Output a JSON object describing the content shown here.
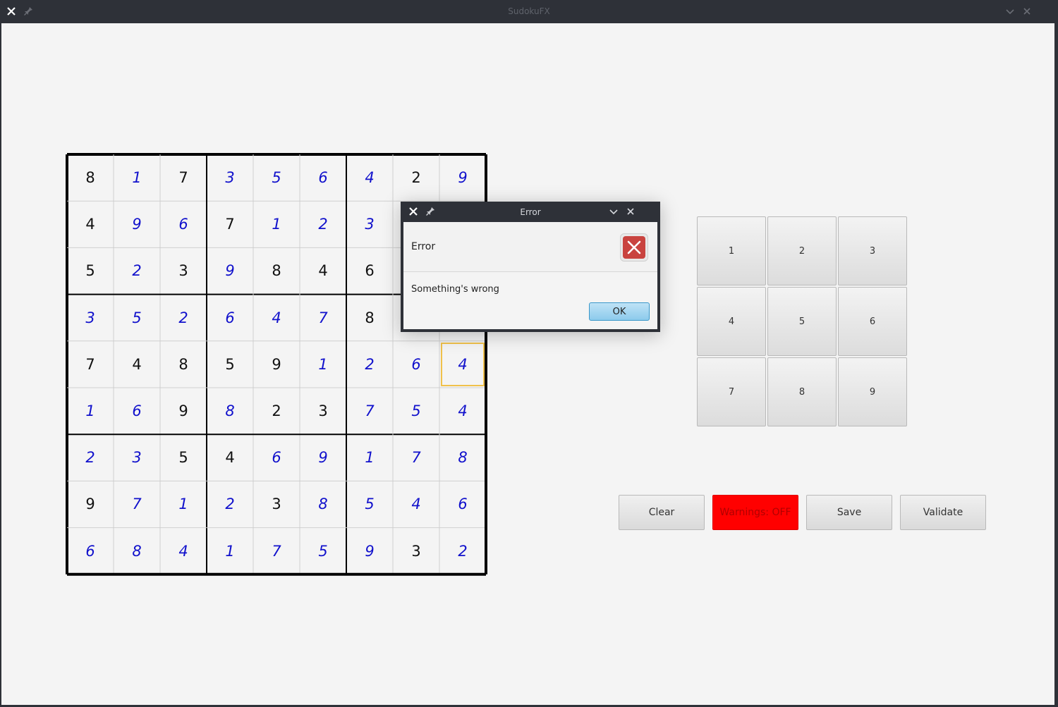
{
  "window": {
    "title": "SudokuFX"
  },
  "board": {
    "rows": [
      [
        {
          "v": "8",
          "t": "given"
        },
        {
          "v": "1",
          "t": "user"
        },
        {
          "v": "7",
          "t": "given"
        },
        {
          "v": "3",
          "t": "user"
        },
        {
          "v": "5",
          "t": "user"
        },
        {
          "v": "6",
          "t": "user"
        },
        {
          "v": "4",
          "t": "user"
        },
        {
          "v": "2",
          "t": "given"
        },
        {
          "v": "9",
          "t": "user"
        }
      ],
      [
        {
          "v": "4",
          "t": "given"
        },
        {
          "v": "9",
          "t": "user"
        },
        {
          "v": "6",
          "t": "user"
        },
        {
          "v": "7",
          "t": "given"
        },
        {
          "v": "1",
          "t": "user"
        },
        {
          "v": "2",
          "t": "user"
        },
        {
          "v": "3",
          "t": "user"
        },
        {
          "v": "",
          "t": "user"
        },
        {
          "v": "",
          "t": "user"
        }
      ],
      [
        {
          "v": "5",
          "t": "given"
        },
        {
          "v": "2",
          "t": "user"
        },
        {
          "v": "3",
          "t": "given"
        },
        {
          "v": "9",
          "t": "user"
        },
        {
          "v": "8",
          "t": "given"
        },
        {
          "v": "4",
          "t": "given"
        },
        {
          "v": "6",
          "t": "given"
        },
        {
          "v": "",
          "t": "user"
        },
        {
          "v": "",
          "t": "user"
        }
      ],
      [
        {
          "v": "3",
          "t": "user"
        },
        {
          "v": "5",
          "t": "user"
        },
        {
          "v": "2",
          "t": "user"
        },
        {
          "v": "6",
          "t": "user"
        },
        {
          "v": "4",
          "t": "user"
        },
        {
          "v": "7",
          "t": "user"
        },
        {
          "v": "8",
          "t": "given"
        },
        {
          "v": "",
          "t": "user"
        },
        {
          "v": "",
          "t": "user"
        }
      ],
      [
        {
          "v": "7",
          "t": "given"
        },
        {
          "v": "4",
          "t": "given"
        },
        {
          "v": "8",
          "t": "given"
        },
        {
          "v": "5",
          "t": "given"
        },
        {
          "v": "9",
          "t": "given"
        },
        {
          "v": "1",
          "t": "user"
        },
        {
          "v": "2",
          "t": "user"
        },
        {
          "v": "6",
          "t": "user"
        },
        {
          "v": "4",
          "t": "user"
        }
      ],
      [
        {
          "v": "1",
          "t": "user"
        },
        {
          "v": "6",
          "t": "user"
        },
        {
          "v": "9",
          "t": "given"
        },
        {
          "v": "8",
          "t": "user"
        },
        {
          "v": "2",
          "t": "given"
        },
        {
          "v": "3",
          "t": "given"
        },
        {
          "v": "7",
          "t": "user"
        },
        {
          "v": "5",
          "t": "user"
        },
        {
          "v": "4",
          "t": "user"
        }
      ],
      [
        {
          "v": "2",
          "t": "user"
        },
        {
          "v": "3",
          "t": "user"
        },
        {
          "v": "5",
          "t": "given"
        },
        {
          "v": "4",
          "t": "given"
        },
        {
          "v": "6",
          "t": "user"
        },
        {
          "v": "9",
          "t": "user"
        },
        {
          "v": "1",
          "t": "user"
        },
        {
          "v": "7",
          "t": "user"
        },
        {
          "v": "8",
          "t": "user"
        }
      ],
      [
        {
          "v": "9",
          "t": "given"
        },
        {
          "v": "7",
          "t": "user"
        },
        {
          "v": "1",
          "t": "user"
        },
        {
          "v": "2",
          "t": "user"
        },
        {
          "v": "3",
          "t": "given"
        },
        {
          "v": "8",
          "t": "user"
        },
        {
          "v": "5",
          "t": "user"
        },
        {
          "v": "4",
          "t": "user"
        },
        {
          "v": "6",
          "t": "user"
        }
      ],
      [
        {
          "v": "6",
          "t": "user"
        },
        {
          "v": "8",
          "t": "user"
        },
        {
          "v": "4",
          "t": "user"
        },
        {
          "v": "1",
          "t": "user"
        },
        {
          "v": "7",
          "t": "user"
        },
        {
          "v": "5",
          "t": "user"
        },
        {
          "v": "9",
          "t": "user"
        },
        {
          "v": "3",
          "t": "given"
        },
        {
          "v": "2",
          "t": "user"
        }
      ]
    ],
    "selected": {
      "row": 4,
      "col": 8
    },
    "colors": {
      "given": "#111111",
      "user": "#1111cc",
      "selection": "#f0c14b"
    }
  },
  "numpad": {
    "labels": [
      "1",
      "2",
      "3",
      "4",
      "5",
      "6",
      "7",
      "8",
      "9"
    ]
  },
  "actions": {
    "clear": "Clear",
    "warnings": "Warnings: OFF",
    "save": "Save",
    "validate": "Validate",
    "warnings_color": "#ff0000"
  },
  "dialog": {
    "title": "Error",
    "header": "Error",
    "message": "Something's wrong",
    "ok": "OK",
    "icon": "error-icon"
  }
}
